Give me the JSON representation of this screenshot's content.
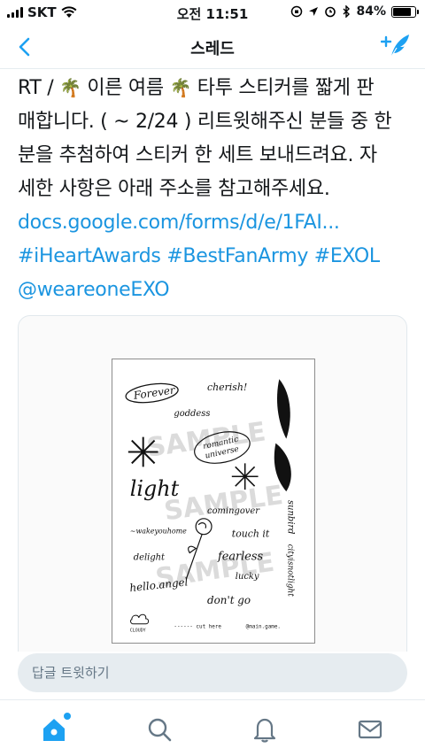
{
  "status": {
    "carrier": "SKT",
    "time": "오전 11:51",
    "battery": "84%",
    "battery_level": 0.84
  },
  "nav": {
    "title": "스레드",
    "back_icon": "chevron-left-icon",
    "compose_icon": "compose-tweet-icon"
  },
  "tweet": {
    "line1_a": "RT / ",
    "line1_b": " 이른 여름 ",
    "line1_c": " 타투 스티커를 짧게 판",
    "emoji": "🌴",
    "line2": "매합니다. ( ~ 2/24 ) 리트윗해주신 분들 중 한",
    "line3": "분을 추첨하여 스티커 한 세트 보내드려요. 자",
    "line4": "세한 사항은 아래 주소를 참고해주세요.",
    "link": "docs.google.com/forms/d/e/1FAI...",
    "hashtags": "#iHeartAwards #BestFanArmy #EXOL",
    "mention": "@weareoneEXO"
  },
  "sticker_sheet": {
    "words": {
      "forever": "Forever",
      "cherish": "cherish!",
      "goddess": "goddess",
      "romantic": "romantic",
      "universe": "universe",
      "light": "light",
      "comingover": "comingover",
      "wakeyouhome": "~wakeyouhome",
      "touchit": "touch it",
      "delight": "delight",
      "fearless": "fearless",
      "lucky": "lucky",
      "helloangel": "hello.angel",
      "dontgo": "don't go",
      "cloudy": "CLOUDY",
      "cuthere": "------ cut here",
      "maingame": "@main.game.",
      "sunbird": "sunbird",
      "cityisnotlight": "cityisnotlight"
    },
    "watermark": "SAMPLE"
  },
  "reply": {
    "placeholder": "답글 트윗하기"
  },
  "tabs": {
    "home": "home-icon",
    "search": "search-icon",
    "notifications": "bell-icon",
    "messages": "mail-icon",
    "accent": "#1da1f2"
  }
}
